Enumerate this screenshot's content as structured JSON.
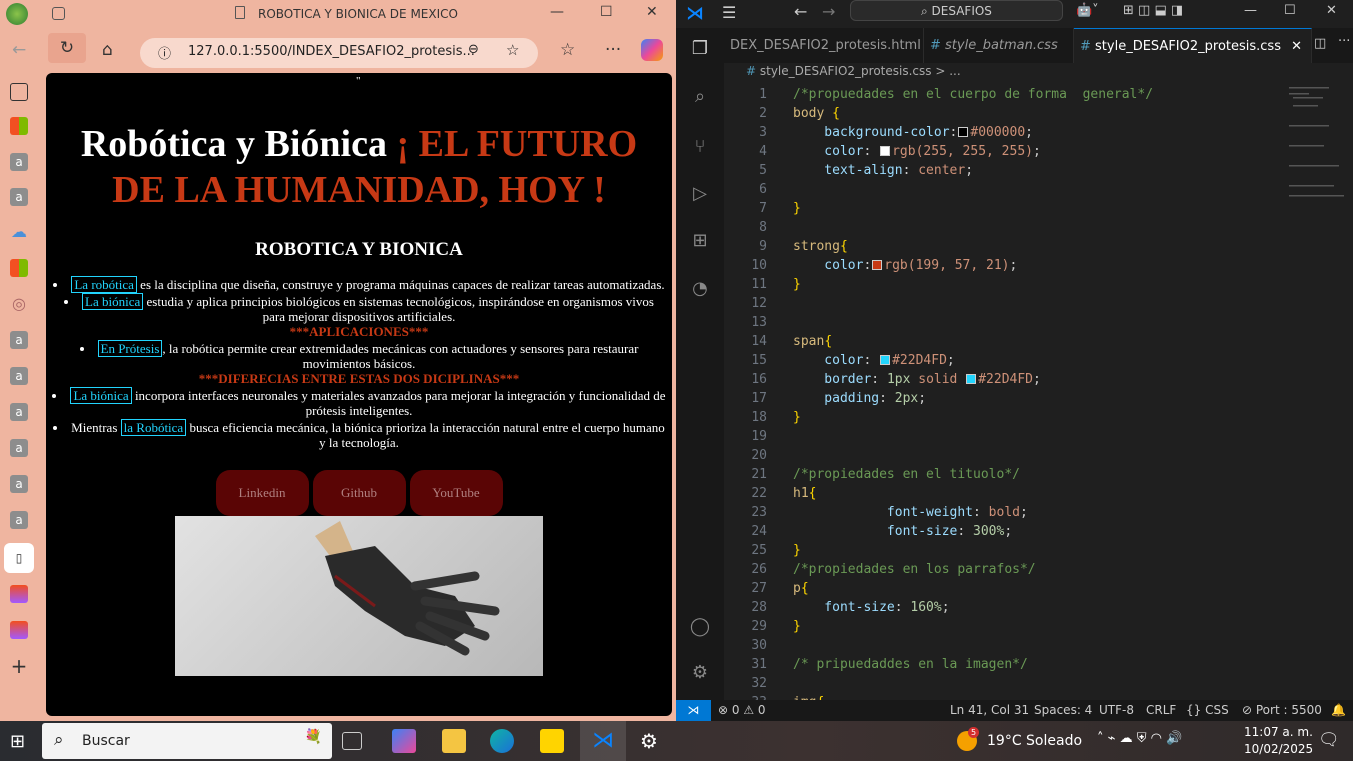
{
  "browser": {
    "title": "ROBOTICA Y BIONICA DE MEXICO",
    "url": "127.0.0.1:5500/INDEX_DESAFIO2_protesis...",
    "page": {
      "quote": "\"",
      "h1_white": "Robótica y Biónica ",
      "h1_red": "¡ EL FUTURO DE LA HUMANIDAD, HOY !",
      "h2": "ROBOTICA Y BIONICA",
      "items": [
        {
          "span": "La robótica",
          "text": " es la disciplina que diseña, construye y programa máquinas capaces de realizar tareas automatizadas."
        },
        {
          "span": "La biónica",
          "text": " estudia y aplica principios biológicos en sistemas tecnológicos, inspirándose en organismos vivos para mejorar dispositivos artificiales.",
          "after": "***APLICACIONES***"
        },
        {
          "span": "En Prótesis",
          "text": ", la robótica permite crear extremidades mecánicas con actuadores y sensores para restaurar movimientos básicos.",
          "after": "***DIFERECIAS ENTRE ESTAS DOS DICIPLINAS***"
        },
        {
          "span": "La biónica",
          "text": " incorpora interfaces neuronales y materiales avanzados para mejorar la integración y funcionalidad de prótesis inteligentes."
        },
        {
          "pre": "Mientras ",
          "span": "la Robótica",
          "text": " busca eficiencia mecánica, la biónica prioriza la interacción natural entre el cuerpo humano y la tecnología."
        }
      ],
      "buttons": [
        "Linkedin",
        "Github",
        "YouTube"
      ]
    }
  },
  "vscode": {
    "search": "DESAFIOS",
    "tabs": [
      "DEX_DESAFIO2_protesis.html",
      "style_batman.css",
      "style_DESAFIO2_protesis.css"
    ],
    "breadcrumb": "style_DESAFIO2_protesis.css > ...",
    "code": [
      [
        [
          "/*propuedades en el cuerpo de forma  general*/",
          "cm"
        ]
      ],
      [
        [
          "body ",
          "se"
        ],
        [
          "{",
          "br"
        ]
      ],
      [
        [
          "    background-color",
          "pr"
        ],
        [
          ":",
          "pu"
        ],
        [
          "#000000",
          "sw"
        ],
        [
          "#000000",
          "va"
        ],
        [
          ";",
          "pu"
        ]
      ],
      [
        [
          "    color",
          "pr"
        ],
        [
          ": ",
          "pu"
        ],
        [
          "#ffffff",
          "sw"
        ],
        [
          "rgb(255, 255, 255)",
          "va"
        ],
        [
          ";",
          "pu"
        ]
      ],
      [
        [
          "    text-align",
          "pr"
        ],
        [
          ": ",
          "pu"
        ],
        [
          "center",
          "va"
        ],
        [
          ";",
          "pu"
        ]
      ],
      [],
      [
        [
          "}",
          "br"
        ]
      ],
      [],
      [
        [
          "strong",
          "se"
        ],
        [
          "{",
          "br"
        ]
      ],
      [
        [
          "    color",
          "pr"
        ],
        [
          ":",
          "pu"
        ],
        [
          "#c73915",
          "sw"
        ],
        [
          "rgb(199, 57, 21)",
          "va"
        ],
        [
          ";",
          "pu"
        ]
      ],
      [
        [
          "}",
          "br"
        ]
      ],
      [],
      [],
      [
        [
          "span",
          "se"
        ],
        [
          "{",
          "br"
        ]
      ],
      [
        [
          "    color",
          "pr"
        ],
        [
          ": ",
          "pu"
        ],
        [
          "#22D4FD",
          "sw"
        ],
        [
          "#22D4FD",
          "va"
        ],
        [
          ";",
          "pu"
        ]
      ],
      [
        [
          "    border",
          "pr"
        ],
        [
          ": ",
          "pu"
        ],
        [
          "1px",
          "nu"
        ],
        [
          " solid ",
          "va"
        ],
        [
          "#22D4FD",
          "sw"
        ],
        [
          "#22D4FD",
          "va"
        ],
        [
          ";",
          "pu"
        ]
      ],
      [
        [
          "    padding",
          "pr"
        ],
        [
          ": ",
          "pu"
        ],
        [
          "2px",
          "nu"
        ],
        [
          ";",
          "pu"
        ]
      ],
      [
        [
          "}",
          "br"
        ]
      ],
      [],
      [],
      [
        [
          "/*propiedades en el tituolo*/",
          "cm"
        ]
      ],
      [
        [
          "h1",
          "se"
        ],
        [
          "{",
          "br"
        ]
      ],
      [
        [
          "            font-weight",
          "pr"
        ],
        [
          ": ",
          "pu"
        ],
        [
          "bold",
          "va"
        ],
        [
          ";",
          "pu"
        ]
      ],
      [
        [
          "            font-size",
          "pr"
        ],
        [
          ": ",
          "pu"
        ],
        [
          "300%",
          "nu"
        ],
        [
          ";",
          "pu"
        ]
      ],
      [
        [
          "}",
          "br"
        ]
      ],
      [
        [
          "/*propiedades en los parrafos*/",
          "cm"
        ]
      ],
      [
        [
          "p",
          "se"
        ],
        [
          "{",
          "br"
        ]
      ],
      [
        [
          "    font-size",
          "pr"
        ],
        [
          ": ",
          "pu"
        ],
        [
          "160%",
          "nu"
        ],
        [
          ";",
          "pu"
        ]
      ],
      [
        [
          "}",
          "br"
        ]
      ],
      [],
      [
        [
          "/* pripuedaddes en la imagen*/",
          "cm"
        ]
      ],
      [],
      [
        [
          "img",
          "se"
        ],
        [
          "{",
          "br"
        ]
      ]
    ],
    "status": {
      "errors": "0",
      "warnings": "0",
      "position": "Ln 41, Col 31",
      "spaces": "Spaces: 4",
      "encoding": "UTF-8",
      "eol": "CRLF",
      "language": "CSS",
      "port": "Port : 5500"
    }
  },
  "taskbar": {
    "search": "Buscar",
    "weather": "19°C  Soleado",
    "weather_badge": "5",
    "time": "11:07 a. m.",
    "date": "10/02/2025"
  }
}
